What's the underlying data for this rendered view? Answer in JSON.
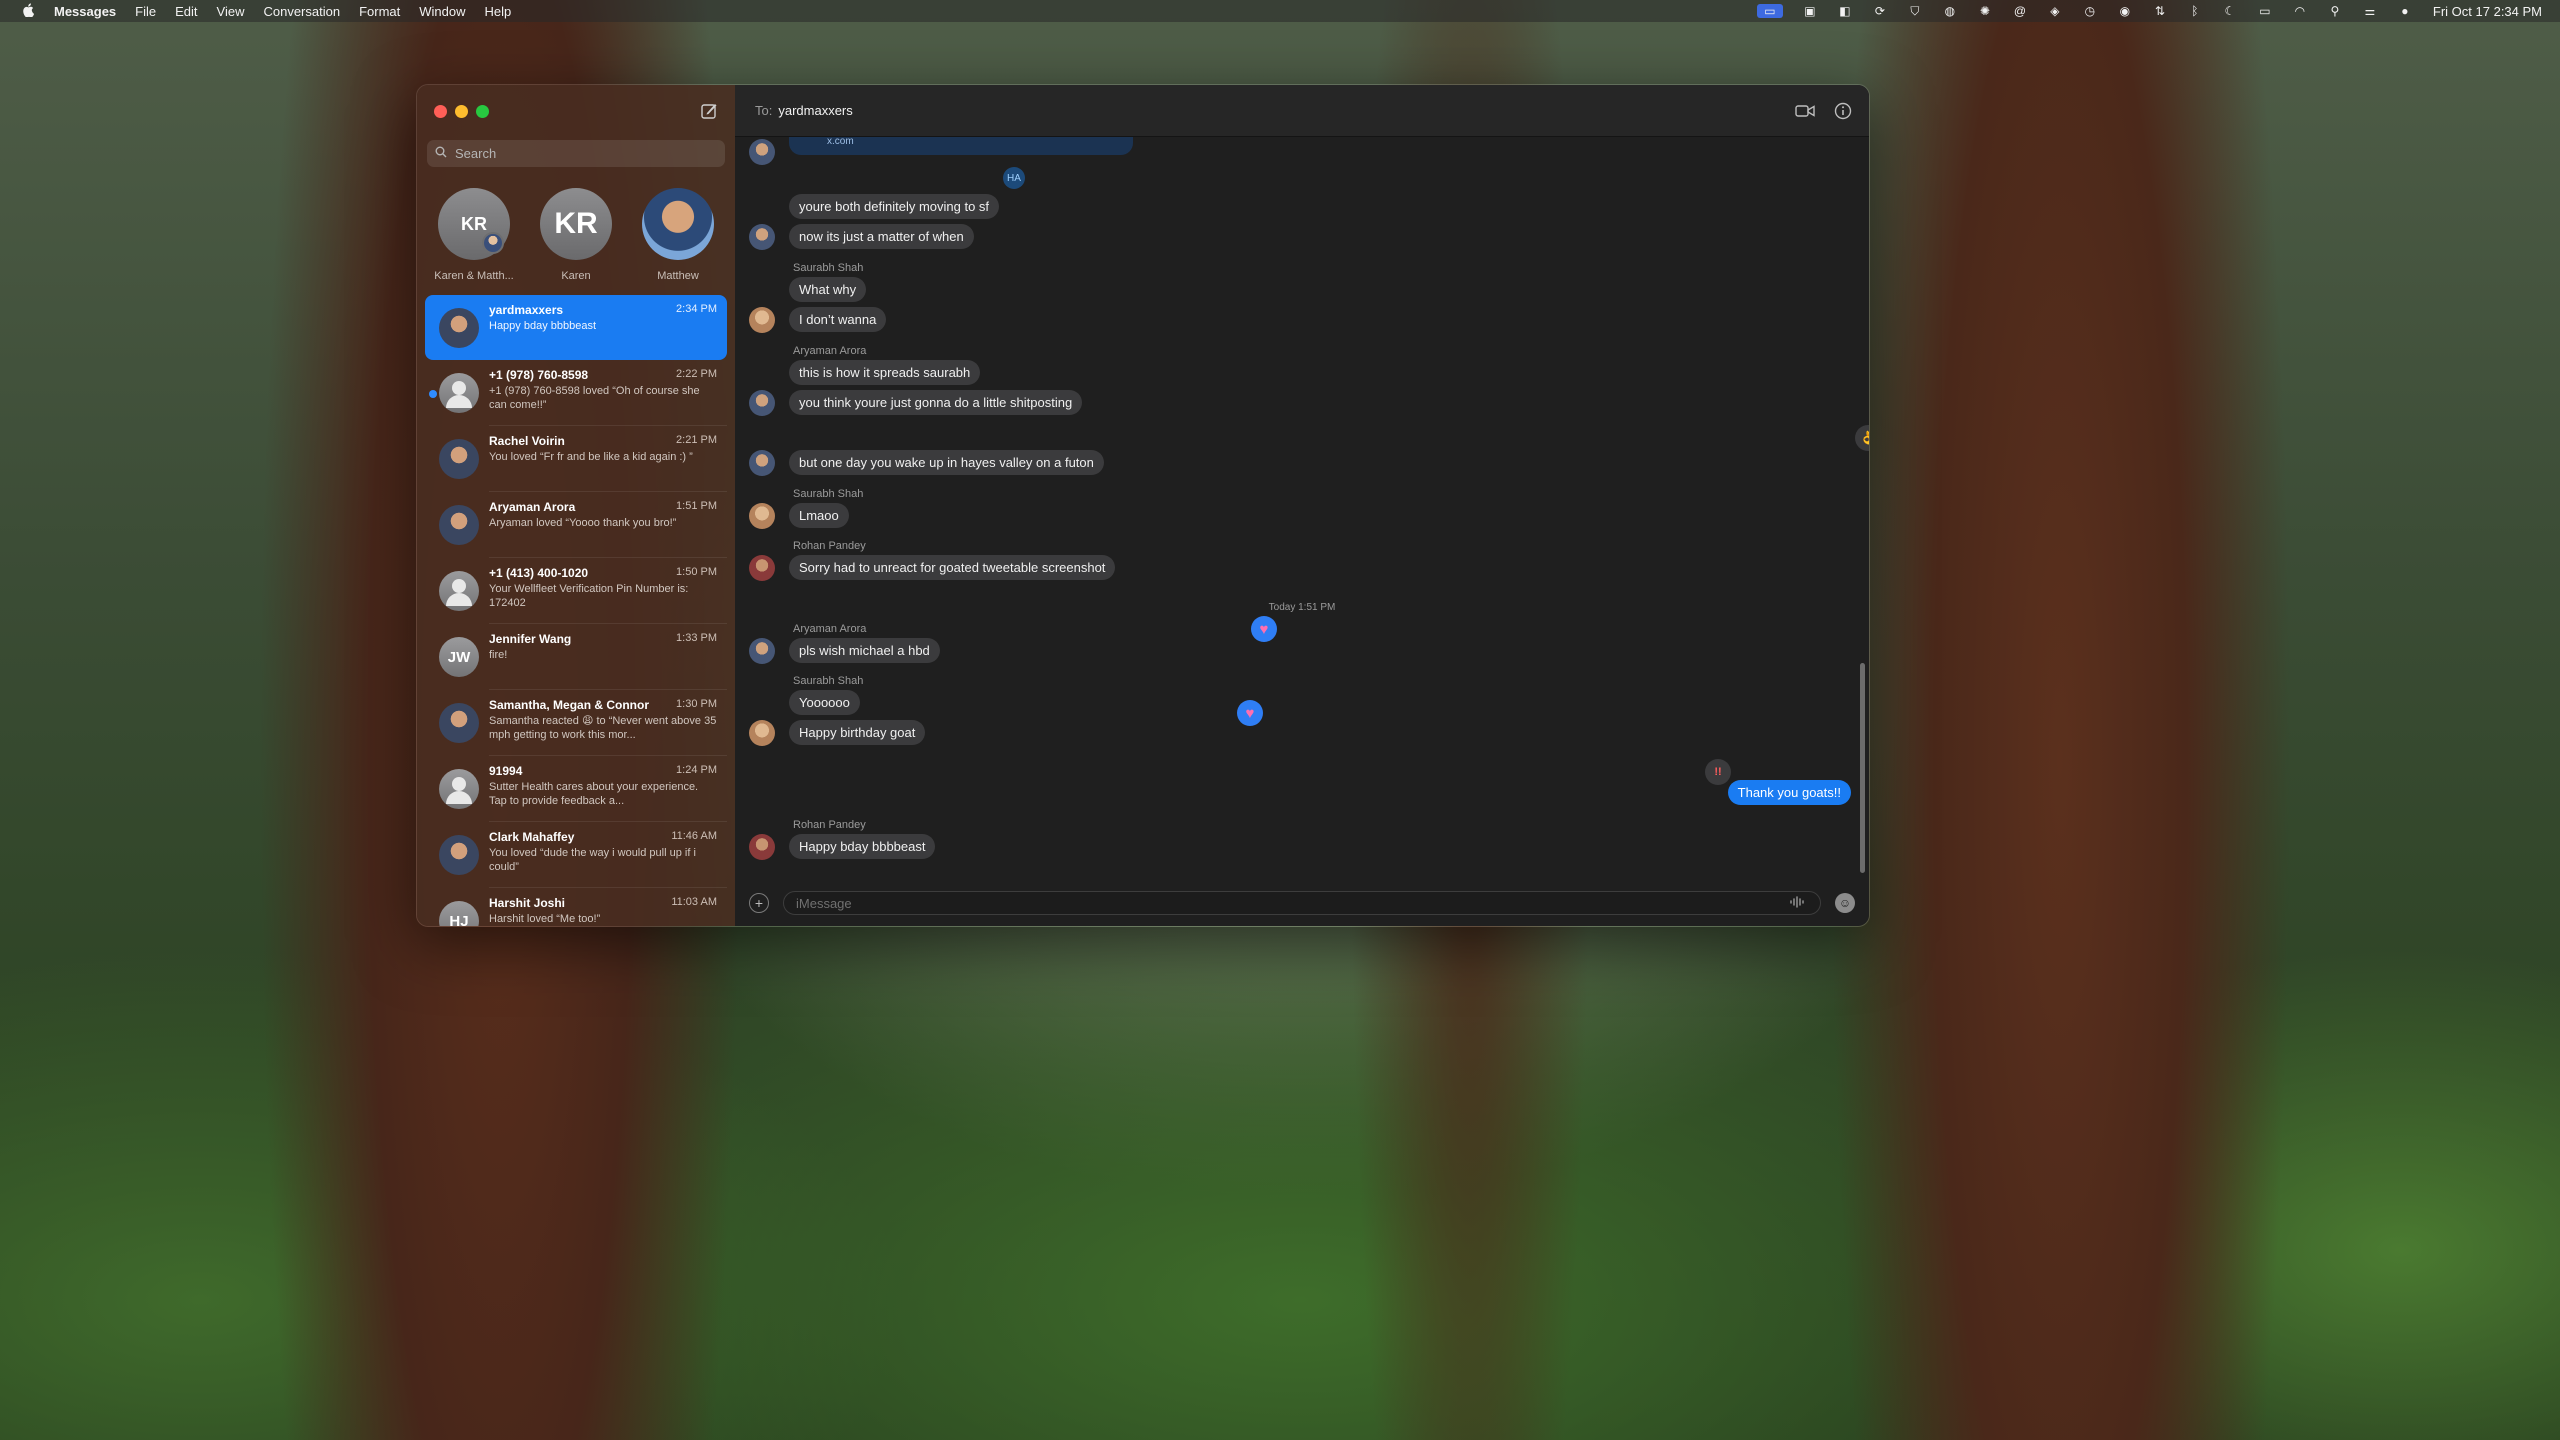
{
  "menubar": {
    "apple": "",
    "app_name": "Messages",
    "items": [
      "File",
      "Edit",
      "View",
      "Conversation",
      "Format",
      "Window",
      "Help"
    ],
    "clock": "Fri Oct 17  2:34 PM"
  },
  "sidebar": {
    "search_placeholder": "Search",
    "pinned": [
      {
        "initials": "KR",
        "label": "Karen & Matth..."
      },
      {
        "initials": "KR",
        "label": "Karen"
      },
      {
        "initials": "",
        "label": "Matthew"
      }
    ],
    "conversations": [
      {
        "name": "yardmaxxers",
        "time": "2:34 PM",
        "preview": "Happy bday bbbbeast",
        "selected": true
      },
      {
        "name": "+1 (978) 760-8598",
        "time": "2:22 PM",
        "preview": "+1 (978) 760-8598 loved “Oh of course she can come!!”",
        "unread": true
      },
      {
        "name": "Rachel Voirin",
        "time": "2:21 PM",
        "preview": "You loved “Fr fr and be like a kid again :) ”"
      },
      {
        "name": "Aryaman Arora",
        "time": "1:51 PM",
        "preview": "Aryaman loved “Yoooo thank you bro!”"
      },
      {
        "name": "+1 (413) 400-1020",
        "time": "1:50 PM",
        "preview": "Your Wellfleet Verification Pin Number is: 172402"
      },
      {
        "name": "Jennifer Wang",
        "time": "1:33 PM",
        "preview": "fire!",
        "initials": "JW"
      },
      {
        "name": "Samantha, Megan & Connor",
        "time": "1:30 PM",
        "preview": "Samantha reacted 😩 to “Never went above 35 mph getting to work this mor..."
      },
      {
        "name": "91994",
        "time": "1:24 PM",
        "preview": "Sutter Health cares about your experience. Tap to provide feedback a..."
      },
      {
        "name": "Clark Mahaffey",
        "time": "11:46 AM",
        "preview": "You loved “dude the way i would pull up if i could”"
      },
      {
        "name": "Harshit Joshi",
        "time": "11:03 AM",
        "preview": "Harshit loved “Me too!”",
        "initials": "HJ"
      }
    ]
  },
  "chat": {
    "to_label": "To:",
    "recipient": "yardmaxxers",
    "link_domain": "x.com",
    "messages": {
      "m1": "youre both definitely moving to sf",
      "m2": "now its just a matter of when",
      "s1": "Saurabh Shah",
      "m3": "What why",
      "m4": "I don’t wanna",
      "s2": "Aryaman Arora",
      "m5": "this is how it spreads saurabh",
      "m6": "you think youre just gonna do a little shitposting",
      "m7": "but one day you wake up in hayes valley on a futon",
      "s3": "Saurabh Shah",
      "m8": "Lmaoo",
      "s4": "Rohan Pandey",
      "m9": "Sorry had to unreact for goated tweetable screenshot",
      "timestamp": "Today 1:51 PM",
      "s5": "Aryaman Arora",
      "m10": "pls wish michael a hbd",
      "s6": "Saurabh Shah",
      "m11": "Yoooooo",
      "m12": "Happy birthday goat",
      "m13": "Thank you goats!!",
      "s7": "Rohan Pandey",
      "m14": "Happy bday bbbbeast"
    },
    "tapbacks": {
      "ha": "HA",
      "emphasis": "!!"
    },
    "input_placeholder": "iMessage"
  },
  "colors": {
    "selected": "#1a7cf2",
    "bubble_incoming": "#3b3b3d",
    "bubble_outgoing": "#1a7cf2"
  }
}
